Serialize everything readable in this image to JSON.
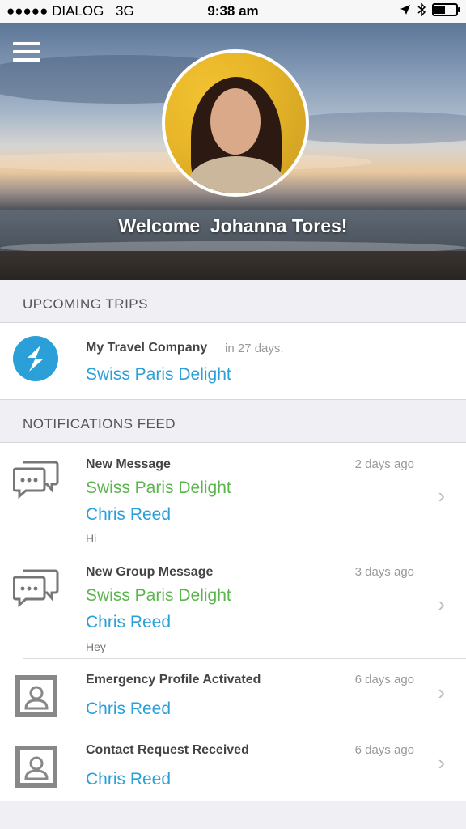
{
  "status_bar": {
    "carrier": "●●●●● DIALOG",
    "network": "3G",
    "time": "9:38 am"
  },
  "header": {
    "welcome_prefix": "Welcome",
    "user_name": "Johanna Tores!"
  },
  "upcoming": {
    "header": "UPCOMING TRIPS",
    "trip": {
      "company": "My Travel Company",
      "when": "in 27 days.",
      "name": "Swiss Paris Delight"
    }
  },
  "feed": {
    "header": "NOTIFICATIONS FEED",
    "items": [
      {
        "title": "New Message",
        "time": "2 days ago",
        "trip": "Swiss Paris Delight",
        "person": "Chris Reed",
        "message": "Hi",
        "icon": "chat-icon"
      },
      {
        "title": "New Group Message",
        "time": "3 days ago",
        "trip": "Swiss Paris Delight",
        "person": "Chris Reed",
        "message": "Hey",
        "icon": "chat-icon"
      },
      {
        "title": "Emergency Profile Activated",
        "time": "6 days ago",
        "person": "Chris Reed",
        "icon": "contact-card-icon"
      },
      {
        "title": "Contact Request Received",
        "time": "6 days ago",
        "person": "Chris Reed",
        "icon": "contact-card-icon"
      }
    ]
  },
  "colors": {
    "accent_blue": "#2a9fd8",
    "accent_green": "#5ab54b",
    "chevron": "#bdbdc2"
  }
}
